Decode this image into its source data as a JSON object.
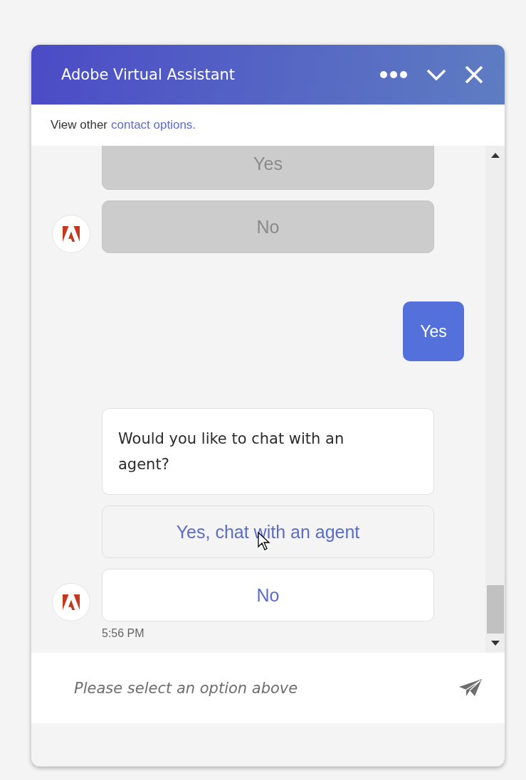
{
  "header": {
    "title": "Adobe Virtual Assistant"
  },
  "contact_bar": {
    "text": "View other",
    "link": "contact options."
  },
  "messages": [
    {
      "kind": "bot",
      "options": [
        {
          "label": "Yes",
          "disabled": true,
          "hovered": false
        },
        {
          "label": "No",
          "disabled": true,
          "hovered": false
        }
      ]
    },
    {
      "kind": "user",
      "text": "Yes"
    },
    {
      "kind": "bot",
      "text": "Would you like to chat with an agent?",
      "options": [
        {
          "label": "Yes, chat with an agent",
          "disabled": false,
          "hovered": true
        },
        {
          "label": "No",
          "disabled": false,
          "hovered": false
        }
      ],
      "time": "5:56 PM"
    }
  ],
  "composer": {
    "placeholder": "Please select an option above"
  }
}
